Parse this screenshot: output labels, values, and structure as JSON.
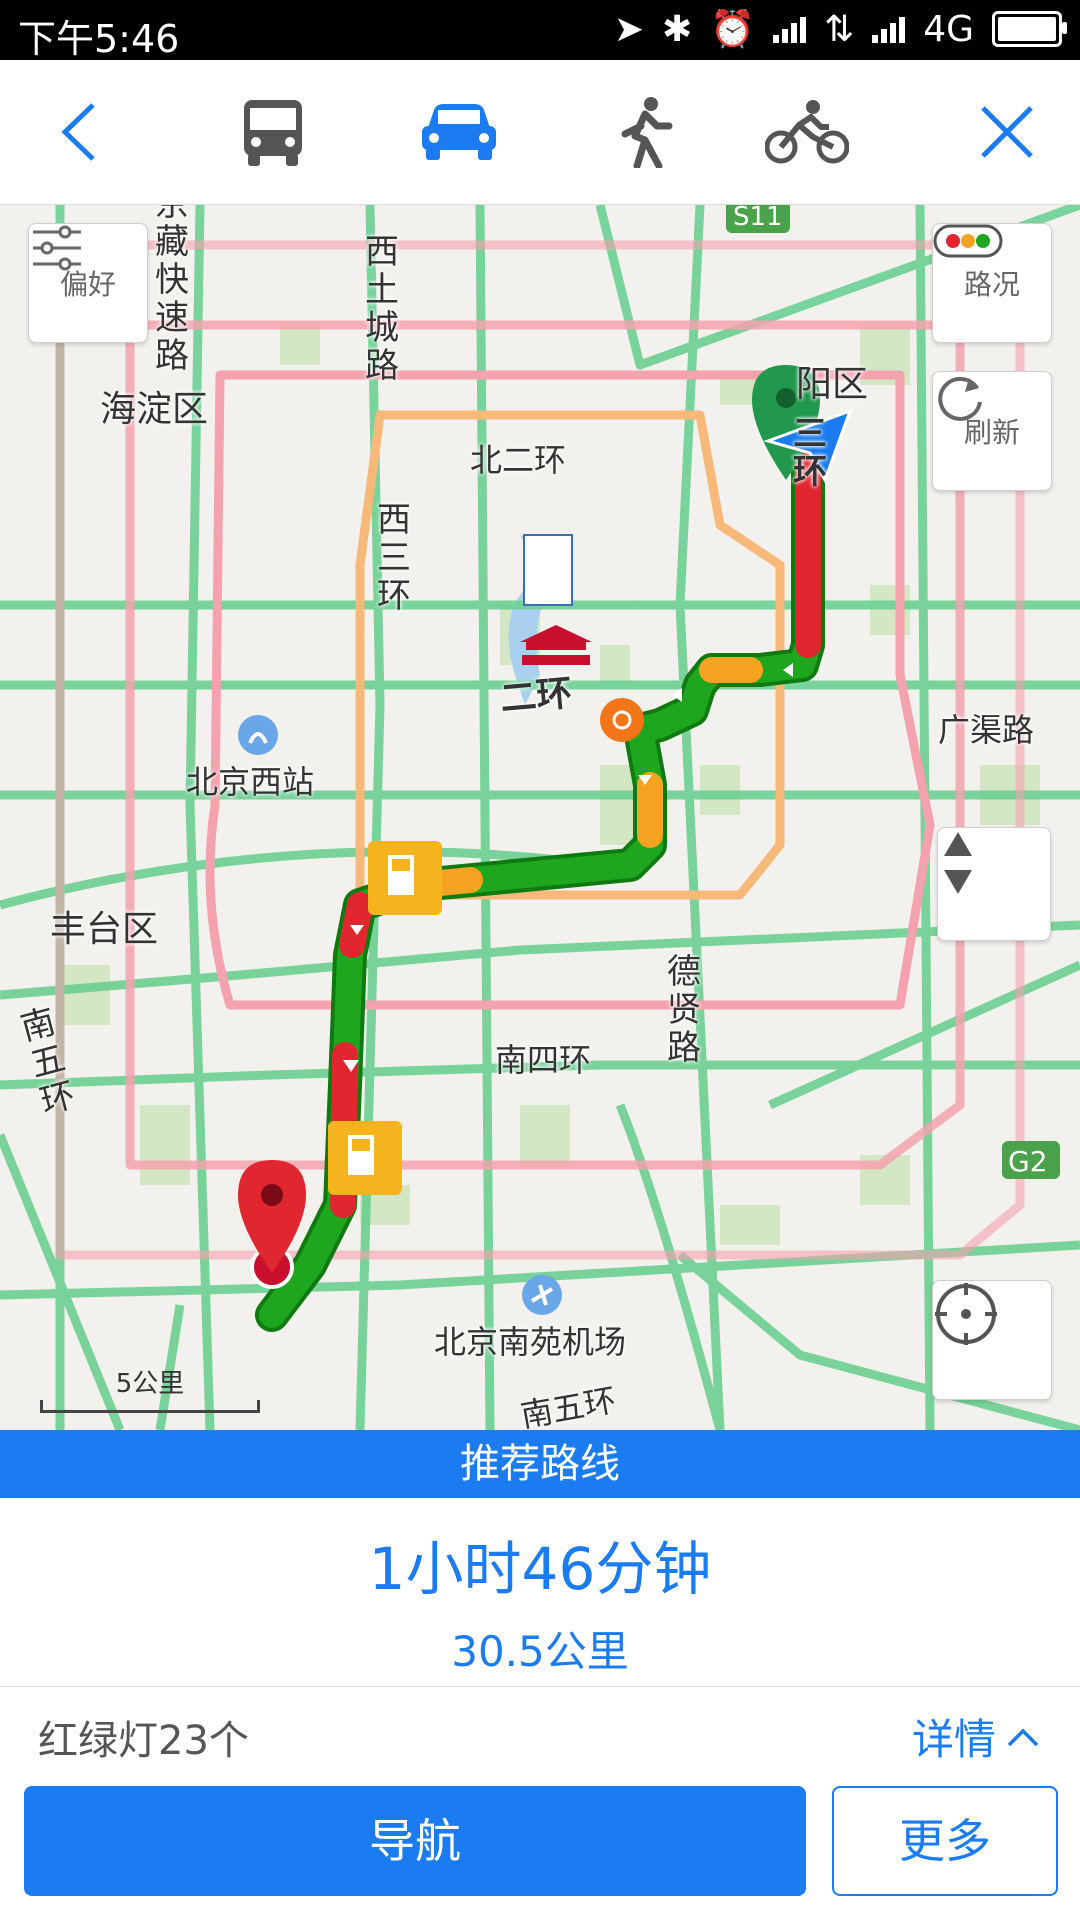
{
  "status_bar": {
    "time": "下午5:46",
    "network": "4G"
  },
  "modes": {
    "back": "back",
    "bus": "bus",
    "car": "car",
    "walk": "walk",
    "bike": "bike",
    "close": "close",
    "active": "car"
  },
  "map": {
    "controls": {
      "preference": "偏好",
      "traffic": "路况",
      "refresh": "刷新"
    },
    "labels": {
      "haidian": "海淀区",
      "chaoyang": "阳区",
      "fengtai": "丰台区",
      "beierhuan": "北二环",
      "xisanhuan": "西三环",
      "xituchenglu": "西土城路",
      "jingzang": "京藏快速路",
      "sanhuan": "三环",
      "erhuan": "二环",
      "guangqulu": "广渠路",
      "beijingxizhan": "北京西站",
      "nansihuan": "南四环",
      "dexianlu": "德贤路",
      "nanwuhuan_left": "南五环",
      "nanwuhuan_bottom": "南五环",
      "nanyuan_airport": "北京南苑机场",
      "s11": "S11",
      "g2": "G2"
    },
    "scale": "5公里"
  },
  "route": {
    "banner": "推荐路线",
    "duration": "1小时46分钟",
    "distance": "30.5公里",
    "traffic_lights": "红绿灯23个",
    "details": "详情"
  },
  "actions": {
    "navigate": "导航",
    "more": "更多"
  },
  "colors": {
    "accent": "#1a7cf0",
    "road_green": "#5cc98a",
    "road_pink": "#f4a2ae",
    "route_green": "#1ea61e",
    "route_red": "#e0262e",
    "route_orange": "#f6a321"
  }
}
